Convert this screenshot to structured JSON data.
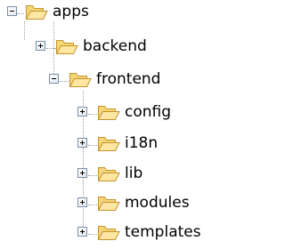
{
  "tree": {
    "root": {
      "label": "apps",
      "expanded": true,
      "icon": "folder-open-icon"
    },
    "children": [
      {
        "label": "backend",
        "expanded": false,
        "icon": "folder-open-icon"
      },
      {
        "label": "frontend",
        "expanded": true,
        "icon": "folder-open-icon",
        "children": [
          {
            "label": "config",
            "expanded": false,
            "icon": "folder-open-icon"
          },
          {
            "label": "i18n",
            "expanded": false,
            "icon": "folder-open-icon"
          },
          {
            "label": "lib",
            "expanded": false,
            "icon": "folder-open-icon"
          },
          {
            "label": "modules",
            "expanded": false,
            "icon": "folder-open-icon"
          },
          {
            "label": "templates",
            "expanded": false,
            "icon": "folder-open-icon"
          }
        ]
      }
    ]
  },
  "colors": {
    "folder_fill": "#f7d87a",
    "folder_stroke": "#c4932b",
    "connector": "#a0a0a0",
    "expander_border": "#7a8ea8"
  }
}
